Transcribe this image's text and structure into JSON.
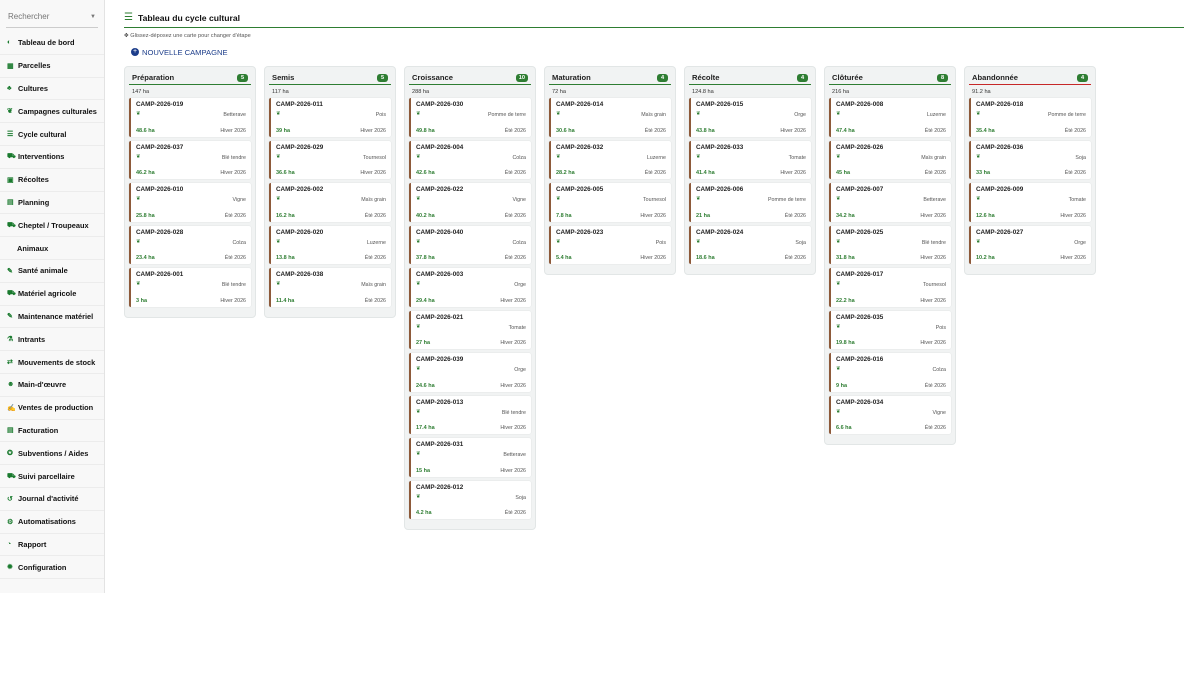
{
  "sidebar": {
    "search_placeholder": "Rechercher",
    "items": [
      {
        "label": "Tableau de bord",
        "icon": "gauge-icon",
        "glyph": "◐"
      },
      {
        "label": "Parcelles",
        "icon": "map-icon",
        "glyph": "▦"
      },
      {
        "label": "Cultures",
        "icon": "seedling-icon",
        "glyph": "♣"
      },
      {
        "label": "Campagnes culturales",
        "icon": "leaf-icon",
        "glyph": "❦"
      },
      {
        "label": "Cycle cultural",
        "icon": "list-icon",
        "glyph": "☰"
      },
      {
        "label": "Interventions",
        "icon": "tractor-icon",
        "glyph": "⛟"
      },
      {
        "label": "Récoltes",
        "icon": "box-icon",
        "glyph": "▣"
      },
      {
        "label": "Planning",
        "icon": "calendar-icon",
        "glyph": "▤"
      },
      {
        "label": "Cheptel / Troupeaux",
        "icon": "cow-icon",
        "glyph": "⛟"
      },
      {
        "label": "Animaux",
        "icon": "",
        "glyph": "",
        "sub": true
      },
      {
        "label": "Santé animale",
        "icon": "syringe-icon",
        "glyph": "✎"
      },
      {
        "label": "Matériel agricole",
        "icon": "tractor-icon",
        "glyph": "⛟"
      },
      {
        "label": "Maintenance matériel",
        "icon": "wrench-icon",
        "glyph": "✎"
      },
      {
        "label": "Intrants",
        "icon": "flask-icon",
        "glyph": "⚗"
      },
      {
        "label": "Mouvements de stock",
        "icon": "arrows-icon",
        "glyph": "⇄"
      },
      {
        "label": "Main-d'œuvre",
        "icon": "person-icon",
        "glyph": "☻"
      },
      {
        "label": "Ventes de production",
        "icon": "handshake-icon",
        "glyph": "✍"
      },
      {
        "label": "Facturation",
        "icon": "invoice-icon",
        "glyph": "▤"
      },
      {
        "label": "Subventions / Aides",
        "icon": "award-icon",
        "glyph": "✪"
      },
      {
        "label": "Suivi parcellaire",
        "icon": "tractor-icon",
        "glyph": "⛟"
      },
      {
        "label": "Journal d'activité",
        "icon": "history-icon",
        "glyph": "↺"
      },
      {
        "label": "Automatisations",
        "icon": "robot-icon",
        "glyph": "⚙"
      },
      {
        "label": "Rapport",
        "icon": "chart-icon",
        "glyph": "◔"
      },
      {
        "label": "Configuration",
        "icon": "gear-icon",
        "glyph": "✹"
      }
    ]
  },
  "header": {
    "title": "Tableau du cycle cultural",
    "hint": "Glissez-déposez une carte pour changer d'étape",
    "new_button": "NOUVELLE CAMPAGNE"
  },
  "colors": {
    "accent": "#2e7d32",
    "card_border": "#8d5a3a",
    "abandoned": "#c62828"
  },
  "columns": [
    {
      "title": "Préparation",
      "count": "5",
      "total": "147 ha",
      "cards": [
        {
          "name": "CAMP-2026-019",
          "crop": "Betterave",
          "area": "48.6 ha",
          "season": "Hiver 2026"
        },
        {
          "name": "CAMP-2026-037",
          "crop": "Blé tendre",
          "area": "46.2 ha",
          "season": "Hiver 2026"
        },
        {
          "name": "CAMP-2026-010",
          "crop": "Vigne",
          "area": "25.8 ha",
          "season": "Été 2026"
        },
        {
          "name": "CAMP-2026-028",
          "crop": "Colza",
          "area": "23.4 ha",
          "season": "Été 2026"
        },
        {
          "name": "CAMP-2026-001",
          "crop": "Blé tendre",
          "area": "3 ha",
          "season": "Hiver 2026"
        }
      ]
    },
    {
      "title": "Semis",
      "count": "5",
      "total": "117 ha",
      "cards": [
        {
          "name": "CAMP-2026-011",
          "crop": "Pois",
          "area": "39 ha",
          "season": "Hiver 2026"
        },
        {
          "name": "CAMP-2026-029",
          "crop": "Tournesol",
          "area": "36.6 ha",
          "season": "Hiver 2026"
        },
        {
          "name": "CAMP-2026-002",
          "crop": "Maïs grain",
          "area": "16.2 ha",
          "season": "Été 2026"
        },
        {
          "name": "CAMP-2026-020",
          "crop": "Luzerne",
          "area": "13.8 ha",
          "season": "Été 2026"
        },
        {
          "name": "CAMP-2026-038",
          "crop": "Maïs grain",
          "area": "11.4 ha",
          "season": "Été 2026"
        }
      ]
    },
    {
      "title": "Croissance",
      "count": "10",
      "total": "288 ha",
      "cards": [
        {
          "name": "CAMP-2026-030",
          "crop": "Pomme de terre",
          "area": "49.8 ha",
          "season": "Été 2026"
        },
        {
          "name": "CAMP-2026-004",
          "crop": "Colza",
          "area": "42.6 ha",
          "season": "Été 2026"
        },
        {
          "name": "CAMP-2026-022",
          "crop": "Vigne",
          "area": "40.2 ha",
          "season": "Été 2026"
        },
        {
          "name": "CAMP-2026-040",
          "crop": "Colza",
          "area": "37.8 ha",
          "season": "Été 2026"
        },
        {
          "name": "CAMP-2026-003",
          "crop": "Orge",
          "area": "29.4 ha",
          "season": "Hiver 2026"
        },
        {
          "name": "CAMP-2026-021",
          "crop": "Tomate",
          "area": "27 ha",
          "season": "Hiver 2026"
        },
        {
          "name": "CAMP-2026-039",
          "crop": "Orge",
          "area": "24.6 ha",
          "season": "Hiver 2026"
        },
        {
          "name": "CAMP-2026-013",
          "crop": "Blé tendre",
          "area": "17.4 ha",
          "season": "Hiver 2026"
        },
        {
          "name": "CAMP-2026-031",
          "crop": "Betterave",
          "area": "15 ha",
          "season": "Hiver 2026"
        },
        {
          "name": "CAMP-2026-012",
          "crop": "Soja",
          "area": "4.2 ha",
          "season": "Été 2026"
        }
      ]
    },
    {
      "title": "Maturation",
      "count": "4",
      "total": "72 ha",
      "cards": [
        {
          "name": "CAMP-2026-014",
          "crop": "Maïs grain",
          "area": "30.6 ha",
          "season": "Été 2026"
        },
        {
          "name": "CAMP-2026-032",
          "crop": "Luzerne",
          "area": "28.2 ha",
          "season": "Été 2026"
        },
        {
          "name": "CAMP-2026-005",
          "crop": "Tournesol",
          "area": "7.8 ha",
          "season": "Hiver 2026"
        },
        {
          "name": "CAMP-2026-023",
          "crop": "Pois",
          "area": "5.4 ha",
          "season": "Hiver 2026"
        }
      ]
    },
    {
      "title": "Récolte",
      "count": "4",
      "total": "124.8 ha",
      "cards": [
        {
          "name": "CAMP-2026-015",
          "crop": "Orge",
          "area": "43.8 ha",
          "season": "Hiver 2026"
        },
        {
          "name": "CAMP-2026-033",
          "crop": "Tomate",
          "area": "41.4 ha",
          "season": "Hiver 2026"
        },
        {
          "name": "CAMP-2026-006",
          "crop": "Pomme de terre",
          "area": "21 ha",
          "season": "Été 2026"
        },
        {
          "name": "CAMP-2026-024",
          "crop": "Soja",
          "area": "18.6 ha",
          "season": "Été 2026"
        }
      ]
    },
    {
      "title": "Clôturée",
      "count": "8",
      "total": "216 ha",
      "cards": [
        {
          "name": "CAMP-2026-008",
          "crop": "Luzerne",
          "area": "47.4 ha",
          "season": "Été 2026"
        },
        {
          "name": "CAMP-2026-026",
          "crop": "Maïs grain",
          "area": "45 ha",
          "season": "Été 2026"
        },
        {
          "name": "CAMP-2026-007",
          "crop": "Betterave",
          "area": "34.2 ha",
          "season": "Hiver 2026"
        },
        {
          "name": "CAMP-2026-025",
          "crop": "Blé tendre",
          "area": "31.8 ha",
          "season": "Hiver 2026"
        },
        {
          "name": "CAMP-2026-017",
          "crop": "Tournesol",
          "area": "22.2 ha",
          "season": "Hiver 2026"
        },
        {
          "name": "CAMP-2026-035",
          "crop": "Pois",
          "area": "19.8 ha",
          "season": "Hiver 2026"
        },
        {
          "name": "CAMP-2026-016",
          "crop": "Colza",
          "area": "9 ha",
          "season": "Été 2026"
        },
        {
          "name": "CAMP-2026-034",
          "crop": "Vigne",
          "area": "6.6 ha",
          "season": "Été 2026"
        }
      ]
    },
    {
      "title": "Abandonnée",
      "count": "4",
      "total": "91.2 ha",
      "cards": [
        {
          "name": "CAMP-2026-018",
          "crop": "Pomme de terre",
          "area": "35.4 ha",
          "season": "Été 2026"
        },
        {
          "name": "CAMP-2026-036",
          "crop": "Soja",
          "area": "33 ha",
          "season": "Été 2026"
        },
        {
          "name": "CAMP-2026-009",
          "crop": "Tomate",
          "area": "12.6 ha",
          "season": "Hiver 2026"
        },
        {
          "name": "CAMP-2026-027",
          "crop": "Orge",
          "area": "10.2 ha",
          "season": "Hiver 2026"
        }
      ]
    }
  ]
}
